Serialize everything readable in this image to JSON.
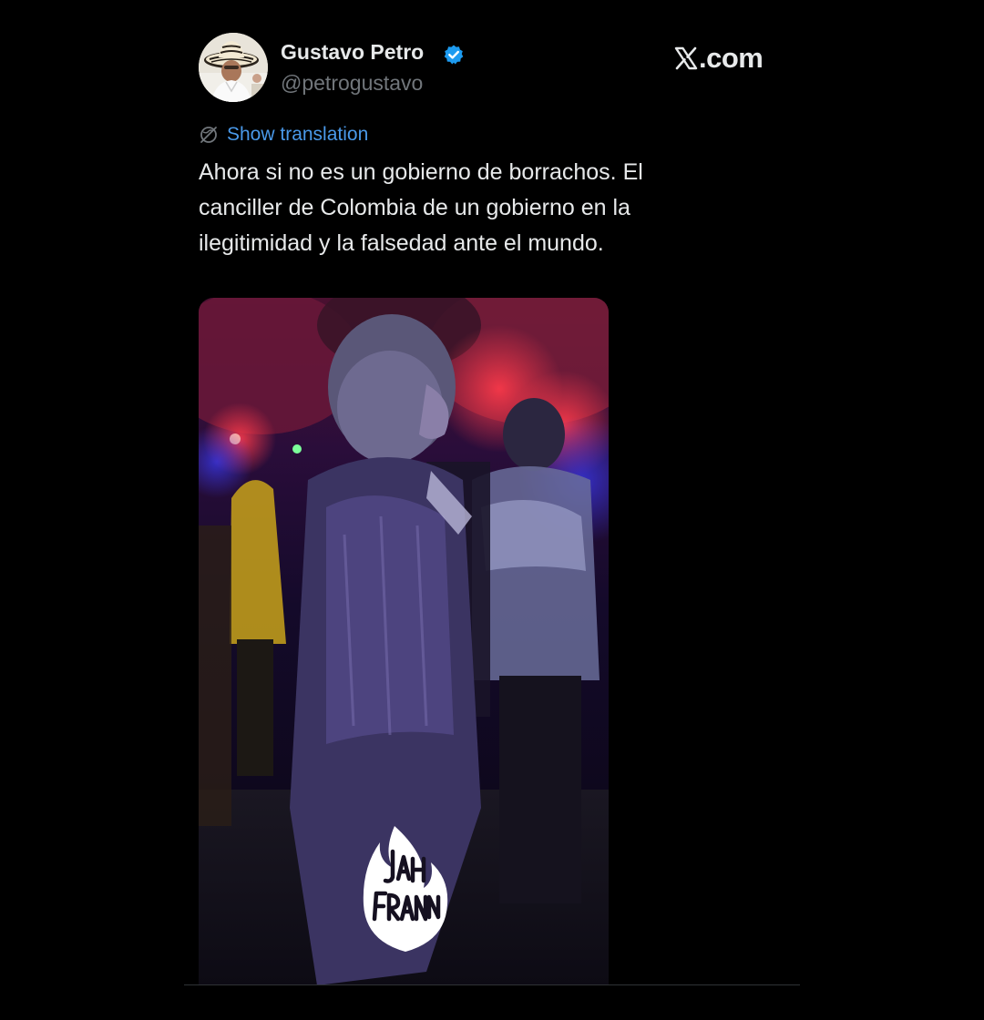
{
  "author": {
    "display_name": "Gustavo Petro",
    "handle": "@petrogustavo",
    "verified_icon": "verified-badge-icon",
    "verified_color": "#1d9bf0"
  },
  "site": {
    "domain_text": ".com",
    "logo_icon": "x-logo-icon"
  },
  "translation": {
    "link_label": "Show translation",
    "icon": "globe-slash-icon",
    "link_color": "#4a99e9"
  },
  "tweet": {
    "text_lines": [
      "Ahora si no es un gobierno de borrachos. El",
      "canciller de Colombia de un gobierno en la",
      "ilegitimidad y la falsedad ante el mundo."
    ]
  },
  "media": {
    "type": "video-still",
    "watermark_text": "JAH FRANN"
  },
  "colors": {
    "background": "#000000",
    "text_primary": "#e7e9ea",
    "text_secondary": "#71767b"
  }
}
